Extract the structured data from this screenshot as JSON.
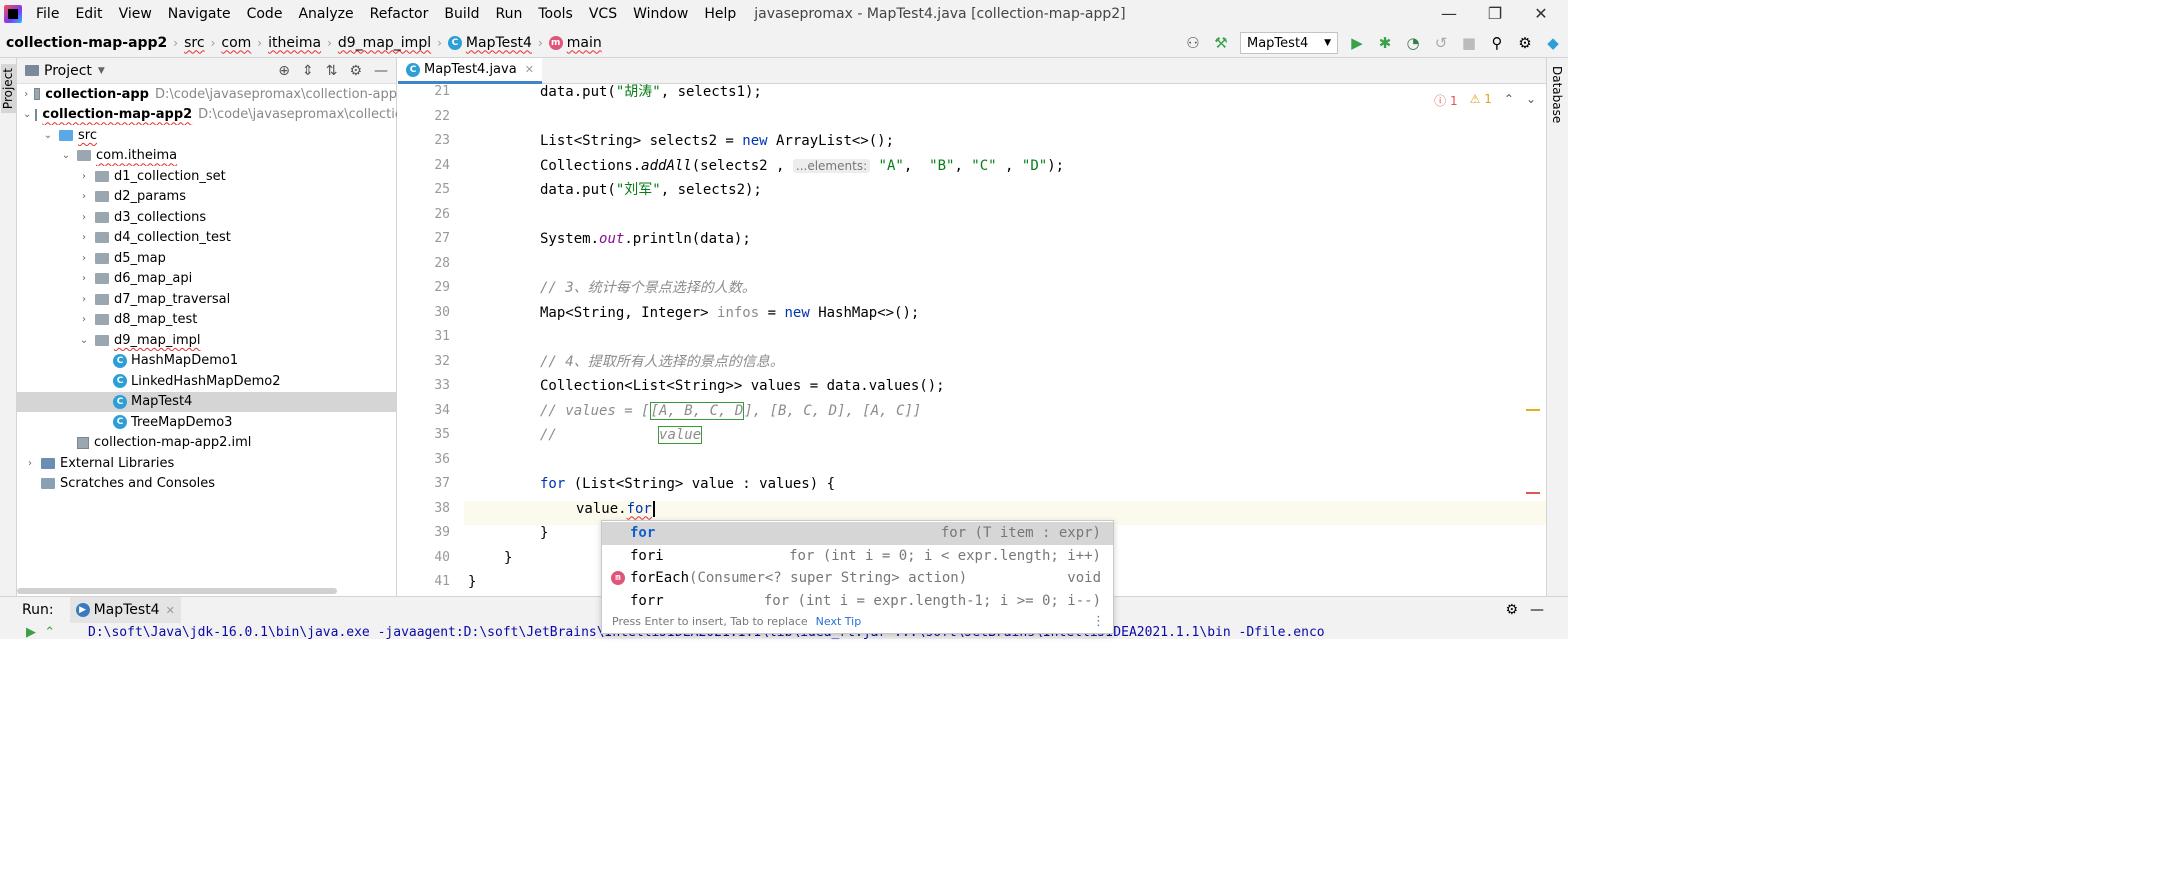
{
  "menubar": {
    "items": [
      "File",
      "Edit",
      "View",
      "Navigate",
      "Code",
      "Analyze",
      "Refactor",
      "Build",
      "Run",
      "Tools",
      "VCS",
      "Window",
      "Help"
    ],
    "title": "javasepromax - MapTest4.java [collection-map-app2]"
  },
  "navbar": {
    "project": "collection-map-app2",
    "crumbs": [
      "src",
      "com",
      "itheima",
      "d9_map_impl",
      "MapTest4",
      "main"
    ],
    "run_config": "MapTest4"
  },
  "left_strip": {
    "label": "Project"
  },
  "right_strip": {
    "label": "Database"
  },
  "project": {
    "header": "Project",
    "tree": [
      {
        "label": "collection-app",
        "path": "D:\\code\\javasepromax\\collection-app",
        "bold": true,
        "arrow": "›"
      },
      {
        "label": "collection-map-app2",
        "path": "D:\\code\\javasepromax\\collection-",
        "bold": true,
        "arrow": "⌄"
      },
      {
        "label": "src",
        "arrow": "⌄"
      },
      {
        "label": "com.itheima",
        "arrow": "⌄"
      },
      {
        "label": "d1_collection_set",
        "arrow": "›"
      },
      {
        "label": "d2_params",
        "arrow": "›"
      },
      {
        "label": "d3_collections",
        "arrow": "›"
      },
      {
        "label": "d4_collection_test",
        "arrow": "›"
      },
      {
        "label": "d5_map",
        "arrow": "›"
      },
      {
        "label": "d6_map_api",
        "arrow": "›"
      },
      {
        "label": "d7_map_traversal",
        "arrow": "›"
      },
      {
        "label": "d8_map_test",
        "arrow": "›"
      },
      {
        "label": "d9_map_impl",
        "arrow": "⌄"
      },
      {
        "label": "HashMapDemo1"
      },
      {
        "label": "LinkedHashMapDemo2"
      },
      {
        "label": "MapTest4"
      },
      {
        "label": "TreeMapDemo3"
      },
      {
        "label": "collection-map-app2.iml"
      },
      {
        "label": "External Libraries",
        "arrow": "›"
      },
      {
        "label": "Scratches and Consoles"
      }
    ]
  },
  "editor": {
    "tab": "MapTest4.java",
    "inspections": {
      "errors": "1",
      "warnings": "1"
    },
    "line_numbers": [
      "21",
      "22",
      "23",
      "24",
      "25",
      "26",
      "27",
      "28",
      "29",
      "30",
      "31",
      "32",
      "33",
      "34",
      "35",
      "36",
      "37",
      "38",
      "39",
      "40",
      "41"
    ]
  },
  "completion": {
    "items": [
      {
        "name": "for",
        "desc": "for (T item : expr)"
      },
      {
        "name": "fori",
        "desc": "for (int i = 0; i < expr.length; i++)"
      },
      {
        "name": "forEach",
        "desc": "(Consumer<? super String> action)",
        "type": "void"
      },
      {
        "name": "forr",
        "desc": "for (int i = expr.length-1; i >= 0; i--)"
      }
    ],
    "footer": "Press Enter to insert, Tab to replace",
    "next_tip": "Next Tip"
  },
  "run": {
    "label": "Run:",
    "tab": "MapTest4",
    "command": "D:\\soft\\Java\\jdk-16.0.1\\bin\\java.exe -javaagent:D:\\soft\\JetBrains\\IntelliJIDEA2021.1.1\\lib\\idea_rt.jar=...\\soft\\JetBrains\\IntelliJIDEA2021.1.1\\bin -Dfile.enco"
  }
}
